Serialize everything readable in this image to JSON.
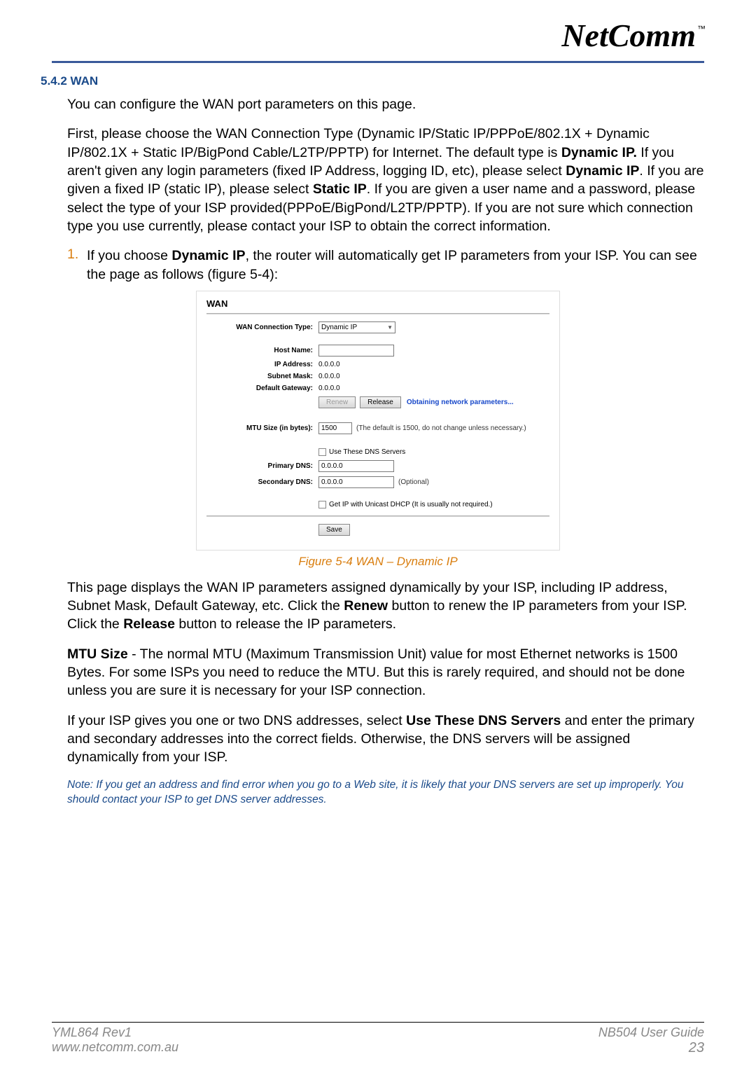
{
  "header": {
    "brand": "NetComm",
    "tm": "™"
  },
  "section": {
    "heading": "5.4.2 WAN",
    "intro": "You can configure the WAN port parameters on this page.",
    "p1a": "First, please choose the WAN Connection Type (Dynamic IP/Static IP/PPPoE/802.1X + Dynamic IP/802.1X + Static IP/BigPond Cable/L2TP/PPTP) for Internet. The default type is ",
    "p1_dynip": "Dynamic IP.",
    "p1b": " If you aren't given any login parameters (fixed IP Address, logging ID, etc), please select ",
    "p1_dynip2": "Dynamic IP",
    "p1c": ". If you are given a fixed IP (static IP), please select ",
    "p1_static": "Static IP",
    "p1d": ". If you are given a user name and a password, please select the type of your ISP provided(PPPoE/BigPond/L2TP/PPTP). If you are not sure which connection type you use currently, please contact your ISP to obtain the correct information.",
    "list": [
      {
        "num": "1.",
        "a": "If you choose ",
        "b": "Dynamic IP",
        "c": ", the router will automatically get IP parameters from your ISP. You can see the page as follows (figure 5-4):"
      }
    ],
    "figcap": "Figure 5-4 WAN – Dynamic IP",
    "p2a": "This page displays the WAN IP parameters assigned dynamically by your ISP, including IP address, Subnet Mask, Default Gateway, etc. Click the ",
    "p2_renew": "Renew",
    "p2b": " button to renew the IP parameters from your ISP. Click the ",
    "p2_release": "Release",
    "p2c": " button to release the IP parameters.",
    "p3_mtu": "MTU Size",
    "p3": " - The normal MTU (Maximum Transmission Unit) value for most Ethernet networks is 1500 Bytes. For some ISPs you need to reduce the MTU. But this is rarely required, and should not be done unless you are sure it is necessary for your ISP connection.",
    "p4a": "If your ISP gives you one or two DNS addresses, select ",
    "p4_use": "Use These DNS Servers",
    "p4b": " and enter the primary and secondary addresses into the correct fields. Otherwise, the DNS servers will be assigned dynamically from your ISP.",
    "note": "Note: If you get an address and find error when you go to a Web site, it is likely that your DNS servers are set up improperly. You should contact your ISP to get DNS server addresses."
  },
  "shot": {
    "title": "WAN",
    "rows": {
      "conn_type": {
        "label": "WAN Connection Type:",
        "value": "Dynamic IP"
      },
      "host": {
        "label": "Host Name:",
        "value": ""
      },
      "ip": {
        "label": "IP Address:",
        "value": "0.0.0.0"
      },
      "mask": {
        "label": "Subnet Mask:",
        "value": "0.0.0.0"
      },
      "gw": {
        "label": "Default Gateway:",
        "value": "0.0.0.0"
      },
      "mtu": {
        "label": "MTU Size (in bytes):",
        "value": "1500",
        "hint": "(The default is 1500, do not change unless necessary.)"
      },
      "usedns": "Use These DNS Servers",
      "pdns": {
        "label": "Primary DNS:",
        "value": "0.0.0.0"
      },
      "sdns": {
        "label": "Secondary DNS:",
        "value": "0.0.0.0",
        "hint": "(Optional)"
      },
      "unicast": "Get IP with Unicast DHCP (It is usually not required.)"
    },
    "buttons": {
      "renew": "Renew",
      "release": "Release",
      "save": "Save"
    },
    "status": "Obtaining network parameters..."
  },
  "footer": {
    "rev": "YML864 Rev1",
    "url": "www.netcomm.com.au",
    "guide": "NB504 User Guide",
    "page": "23"
  }
}
